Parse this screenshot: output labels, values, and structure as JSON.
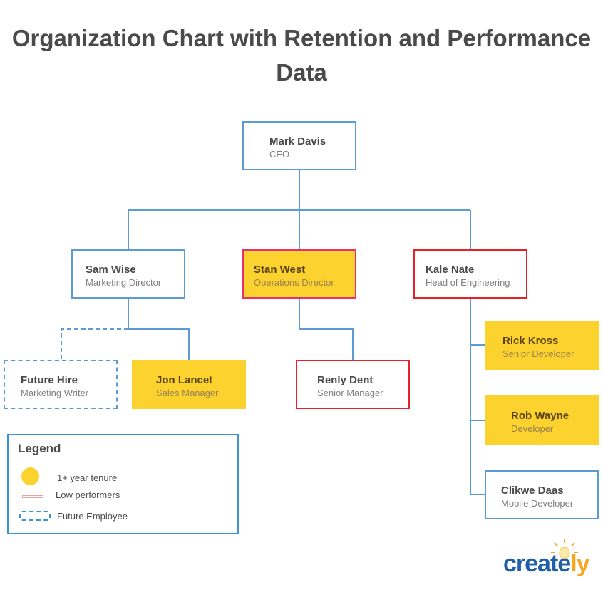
{
  "title": "Organization Chart with Retention and Performance Data",
  "colors": {
    "connector": "#5b9bd5",
    "tenure_fill": "#fcd22e",
    "low_performer_border": "#e8202a",
    "legend_border": "#3b93d6",
    "title_text": "#4a4a4a"
  },
  "nodes": {
    "mark_davis": {
      "name": "Mark Davis",
      "role": "CEO",
      "tenure_1yr_plus": false,
      "low_performer": false,
      "future": false
    },
    "sam_wise": {
      "name": "Sam Wise",
      "role": "Marketing Director",
      "tenure_1yr_plus": false,
      "low_performer": false,
      "future": false
    },
    "stan_west": {
      "name": "Stan West",
      "role": "Operations Director",
      "tenure_1yr_plus": true,
      "low_performer": true,
      "future": false
    },
    "kale_nate": {
      "name": "Kale Nate",
      "role": "Head of Engineering",
      "tenure_1yr_plus": false,
      "low_performer": true,
      "future": false
    },
    "future_hire": {
      "name": "Future Hire",
      "role": "Marketing Writer",
      "tenure_1yr_plus": false,
      "low_performer": false,
      "future": true
    },
    "jon_lancet": {
      "name": "Jon Lancet",
      "role": "Sales Manager",
      "tenure_1yr_plus": true,
      "low_performer": false,
      "future": false
    },
    "renly_dent": {
      "name": "Renly Dent",
      "role": "Senior Manager",
      "tenure_1yr_plus": false,
      "low_performer": true,
      "future": false
    },
    "rick_kross": {
      "name": "Rick Kross",
      "role": "Senior Developer",
      "tenure_1yr_plus": true,
      "low_performer": false,
      "future": false
    },
    "rob_wayne": {
      "name": "Rob Wayne",
      "role": "Developer",
      "tenure_1yr_plus": true,
      "low_performer": false,
      "future": false
    },
    "clikwe_daas": {
      "name": "Clikwe Daas",
      "role": "Mobile Developer",
      "tenure_1yr_plus": false,
      "low_performer": false,
      "future": false
    }
  },
  "hierarchy": [
    {
      "parent": "Mark Davis",
      "children": [
        "Sam Wise",
        "Stan West",
        "Kale Nate"
      ]
    },
    {
      "parent": "Sam Wise",
      "children": [
        "Future Hire",
        "Jon Lancet"
      ]
    },
    {
      "parent": "Stan West",
      "children": [
        "Renly Dent"
      ]
    },
    {
      "parent": "Kale Nate",
      "children": [
        "Rick Kross",
        "Rob Wayne",
        "Clikwe Daas"
      ]
    }
  ],
  "legend": {
    "title": "Legend",
    "items": [
      {
        "label": "1+ year tenure",
        "swatch": "yellow-circle"
      },
      {
        "label": "Low performers",
        "swatch": "red-outline-rect"
      },
      {
        "label": "Future Employee",
        "swatch": "dashed-blue-rect"
      }
    ]
  },
  "logo": {
    "text_main": "create",
    "text_accent": "ly",
    "icon": "lightbulb-icon"
  }
}
